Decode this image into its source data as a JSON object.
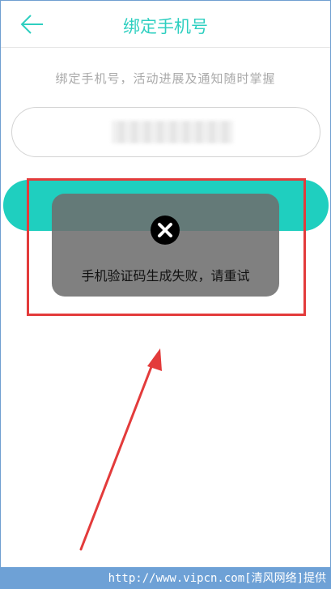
{
  "header": {
    "back_icon": "arrow-left-icon",
    "title": "绑定手机号"
  },
  "main": {
    "subtitle": "绑定手机号，活动进展及通知随时掌握",
    "phone_input": {
      "value": "",
      "placeholder": ""
    }
  },
  "toast": {
    "icon": "close-circle-icon",
    "message": "手机验证码生成失败，请重试"
  },
  "annotations": {
    "highlight_color": "#e33b3b",
    "arrow_color": "#e33b3b"
  },
  "footer": {
    "watermark": "http://www.vipcn.com[清风网络]提供"
  },
  "colors": {
    "accent": "#2ecfc0",
    "button": "#1fcfbf",
    "toast_bg": "#6e6e6e"
  }
}
